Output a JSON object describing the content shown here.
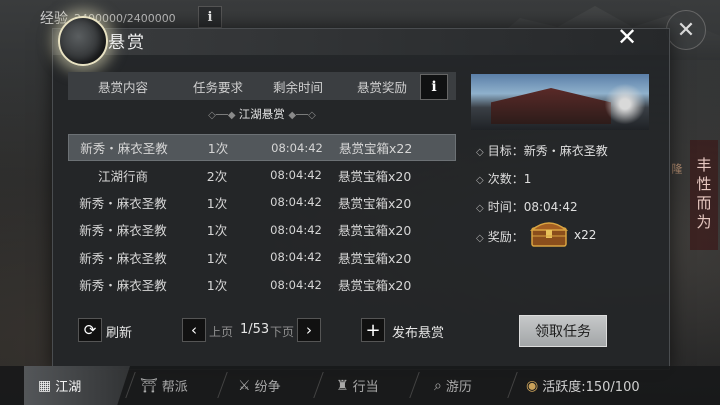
{
  "top": {
    "exp_label": "经验",
    "exp_value": "2400000/2400000",
    "info_glyph": "i",
    "close_glyph": "✕"
  },
  "side": {
    "deco_text": "丰性而为",
    "tag_text": "隆"
  },
  "panel": {
    "title": "悬赏",
    "close_glyph": "✕"
  },
  "table": {
    "headers": [
      "悬赏内容",
      "任务要求",
      "剩余时间",
      "悬赏奖励"
    ],
    "info_glyph": "i",
    "section": "江湖悬赏",
    "rows": [
      {
        "content": "新秀・麻衣圣教",
        "req": "1次",
        "time": "08:04:42",
        "reward": "悬赏宝箱x22",
        "selected": true
      },
      {
        "content": "江湖行商",
        "req": "2次",
        "time": "08:04:42",
        "reward": "悬赏宝箱x20",
        "selected": false
      },
      {
        "content": "新秀・麻衣圣教",
        "req": "1次",
        "time": "08:04:42",
        "reward": "悬赏宝箱x20",
        "selected": false
      },
      {
        "content": "新秀・麻衣圣教",
        "req": "1次",
        "time": "08:04:42",
        "reward": "悬赏宝箱x20",
        "selected": false
      },
      {
        "content": "新秀・麻衣圣教",
        "req": "1次",
        "time": "08:04:42",
        "reward": "悬赏宝箱x20",
        "selected": false
      },
      {
        "content": "新秀・麻衣圣教",
        "req": "1次",
        "time": "08:04:42",
        "reward": "悬赏宝箱x20",
        "selected": false
      }
    ]
  },
  "detail": {
    "target": "目标：新秀・麻衣圣教",
    "count": "次数：1",
    "time": "时间：08:04:42",
    "reward_label": "奖励：",
    "reward_count": "x22"
  },
  "controls": {
    "refresh": "刷新",
    "prev": "上页",
    "page": "1/53",
    "next": "下页",
    "publish": "发布悬赏",
    "claim": "领取任务"
  },
  "nav": {
    "items": [
      "江湖",
      "帮派",
      "纷争",
      "行当",
      "游历"
    ],
    "activity": "活跃度:150/100"
  },
  "colors": {
    "panel_bg": "#242628",
    "selected_row": "#52575b",
    "claim_button": "#b5b7b8",
    "moon_glow": "#e8e2c2"
  }
}
